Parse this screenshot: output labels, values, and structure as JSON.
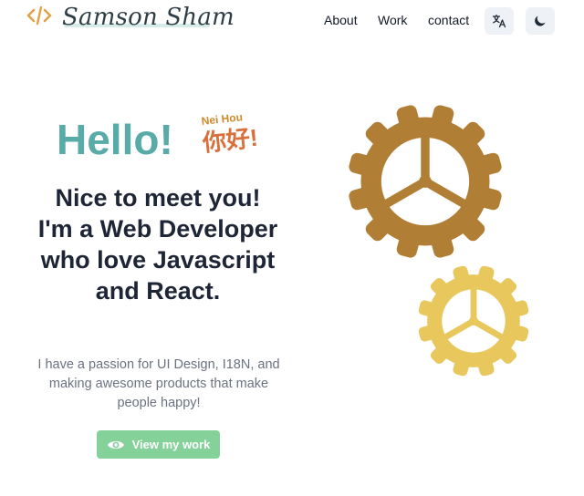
{
  "header": {
    "logo_text": "Samson Sham",
    "nav": [
      "About",
      "Work",
      "contact"
    ]
  },
  "icons": {
    "logo": "code-brackets-icon",
    "translate": "translate-icon",
    "theme": "moon-icon",
    "cta": "eye-icon",
    "gear": "gear-icon"
  },
  "hero": {
    "hello": "Hello!",
    "nei_hou": "Nei Hou",
    "nihao": "你好!",
    "headline_lines": [
      "Nice to meet you!",
      "I'm a Web Developer",
      "who love Javascript",
      "and React."
    ],
    "tagline": "I have a passion for UI Design, I18N, and making awesome products that make people happy!",
    "cta_label": "View my work"
  },
  "colors": {
    "hello": "#59aba7",
    "accent_orange": "#d9703b",
    "gear_large": "#b07e35",
    "gear_small": "#e8c75c",
    "cta": "#84d19a"
  }
}
